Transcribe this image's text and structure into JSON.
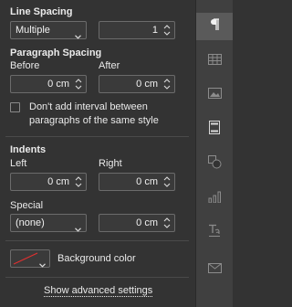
{
  "line_spacing": {
    "heading": "Line Spacing",
    "mode": "Multiple",
    "value": "1"
  },
  "paragraph_spacing": {
    "heading": "Paragraph Spacing",
    "before_label": "Before",
    "before_value": "0 cm",
    "after_label": "After",
    "after_value": "0 cm",
    "no_interval_label_line1": "Don't add interval between",
    "no_interval_label_line2": "paragraphs of the same style"
  },
  "indents": {
    "heading": "Indents",
    "left_label": "Left",
    "left_value": "0 cm",
    "right_label": "Right",
    "right_value": "0 cm",
    "special_label": "Special",
    "special_mode": "(none)",
    "special_value": "0 cm"
  },
  "background": {
    "label": "Background color",
    "swatch": "no-fill"
  },
  "advanced_link": "Show advanced settings",
  "rail": {
    "items": [
      "paragraph-icon",
      "table-icon",
      "image-icon",
      "header-footer-icon",
      "shape-icon",
      "chart-icon",
      "text-art-icon",
      "mail-merge-icon"
    ],
    "active": "paragraph-icon"
  },
  "colors": {
    "panel_bg": "#333333",
    "rail_bg": "#404040",
    "rail_active": "#5a5a5a",
    "swatch_slash": "#e03030"
  }
}
